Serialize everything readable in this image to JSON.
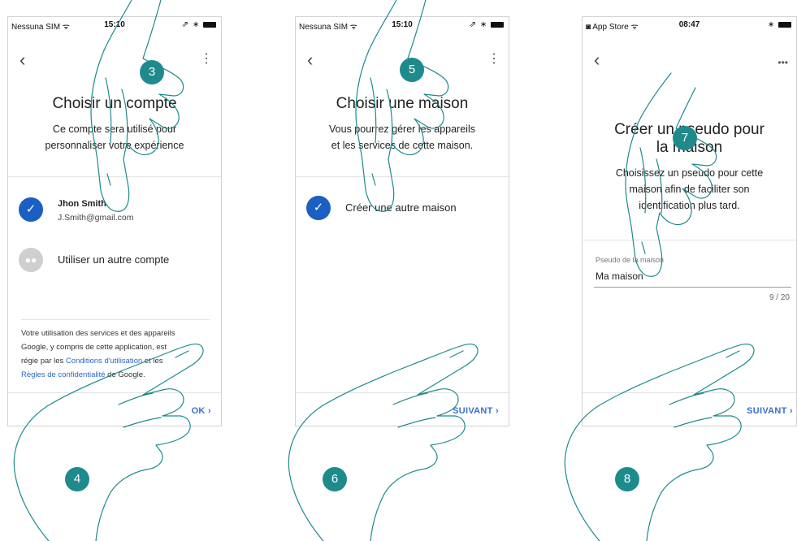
{
  "screens": [
    {
      "status": {
        "carrier": "Nessuna SIM ᯤ",
        "time": "15:10",
        "icons": "⇗ ∗"
      },
      "title": "Choisir un compte",
      "subtitle": [
        "Ce compte sera utilisé pour",
        "personnaliser votre expérience"
      ],
      "account": {
        "name": "Jhon Smith",
        "email": "J.Smith@gmail.com"
      },
      "other_account_label": "Utiliser un autre compte",
      "footer": {
        "line1": "Votre utilisation des services et des appareils",
        "line2": "Google, y compris de cette application, est",
        "line3_pre": "régie par les ",
        "terms_link": "Conditions d'utilisation",
        "line3_post": " et les",
        "privacy_link": "Règles de confidentialité",
        "line4_post": " de Google."
      },
      "action": "OK ›",
      "steps": [
        "3",
        "4"
      ]
    },
    {
      "status": {
        "carrier": "Nessuna SIM ᯤ",
        "time": "15:10",
        "icons": "⇗ ∗"
      },
      "title": "Choisir une maison",
      "subtitle": [
        "Vous pourrez gérer les appareils",
        "et les services de cette maison."
      ],
      "option_label": "Créer une autre maison",
      "action": "SUIVANT ›",
      "steps": [
        "5",
        "6"
      ]
    },
    {
      "status": {
        "carrier": "◙ App Store ᯤ",
        "time": "08:47",
        "icons": "∗"
      },
      "title": [
        "Créer un pseudo pour",
        "la maison"
      ],
      "subtitle": [
        "Choisissez un pseudo pour cette",
        "maison afin de faciliter son",
        "identification plus tard."
      ],
      "field_label": "Pseudo de la maison",
      "field_value": "Ma maison",
      "counter": "9 / 20",
      "action": "SUIVANT ›",
      "steps": [
        "7",
        "8"
      ]
    }
  ],
  "colors": {
    "accent": "#1a5fc1",
    "link": "#2a67c6",
    "badge": "#1e8a8c",
    "hand_stroke": "#1e8a8c"
  },
  "icons": {
    "back": "chevron-left-icon",
    "menu": "more-vert-icon",
    "check": "check-icon",
    "person": "people-icon"
  }
}
